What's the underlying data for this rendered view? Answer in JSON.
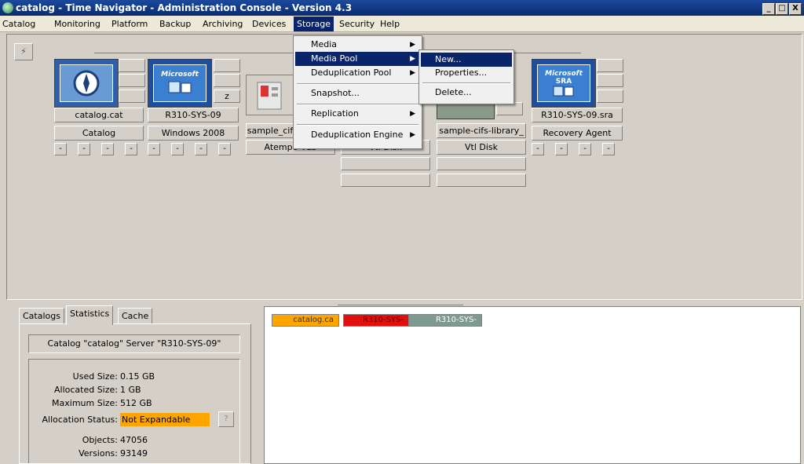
{
  "window": {
    "title": "catalog - Time Navigator - Administration Console - Version 4.3",
    "buttons": [
      "_",
      "□",
      "X"
    ]
  },
  "menubar": [
    "Catalog",
    "Monitoring",
    "Platform",
    "Backup",
    "Archiving",
    "Devices",
    "Storage",
    "Security",
    "Help"
  ],
  "menus": {
    "storage": [
      "Media",
      "Media Pool",
      "Deduplication Pool",
      "Snapshot...",
      "Replication",
      "Deduplication Engine"
    ],
    "media_pool": [
      "New...",
      "Properties...",
      "Delete..."
    ]
  },
  "nodes": [
    {
      "name": "catalog.cat",
      "type": "Catalog"
    },
    {
      "name": "R310-SYS-09",
      "type": "Windows 2008",
      "icon_label": "Microsoft"
    },
    {
      "name": "sample_cif",
      "type": "Atempo VLS"
    },
    {
      "name": "",
      "type": "Vtl Disk"
    },
    {
      "name": "sample-cifs-library_",
      "type": "Vtl Disk"
    },
    {
      "name": "R310-SYS-09.sra",
      "type": "Recovery Agent",
      "icon_label": "Microsoft",
      "icon_sub": "SRA"
    }
  ],
  "small_buttons": [
    "-",
    "-",
    "-",
    "-"
  ],
  "node_marker": "z",
  "tabs": [
    "Catalogs",
    "Statistics",
    "Cache"
  ],
  "active_tab": "Statistics",
  "catalog_header": "Catalog \"catalog\" Server \"R310-SYS-09\"",
  "stats": [
    {
      "label": "Used Size:",
      "value": "0.15 GB"
    },
    {
      "label": "Allocated Size:",
      "value": "1 GB"
    },
    {
      "label": "Maximum Size:",
      "value": "512 GB"
    },
    {
      "label": "Allocation Status:",
      "value": "Not Expandable"
    },
    {
      "label": "Objects:",
      "value": "47056"
    },
    {
      "label": "Versions:",
      "value": "93149"
    }
  ],
  "help_button": "?",
  "chips": [
    "catalog.ca",
    "R310-SYS-",
    "R310-SYS-"
  ],
  "colors": {
    "title_bar": "#0a2a6e",
    "menu_highlight": "#0a246a",
    "allocation_status": "#ffa500",
    "chip_catalog": "#ffa500",
    "chip_server": "#e01010",
    "chip_agent": "#7f9a90"
  }
}
